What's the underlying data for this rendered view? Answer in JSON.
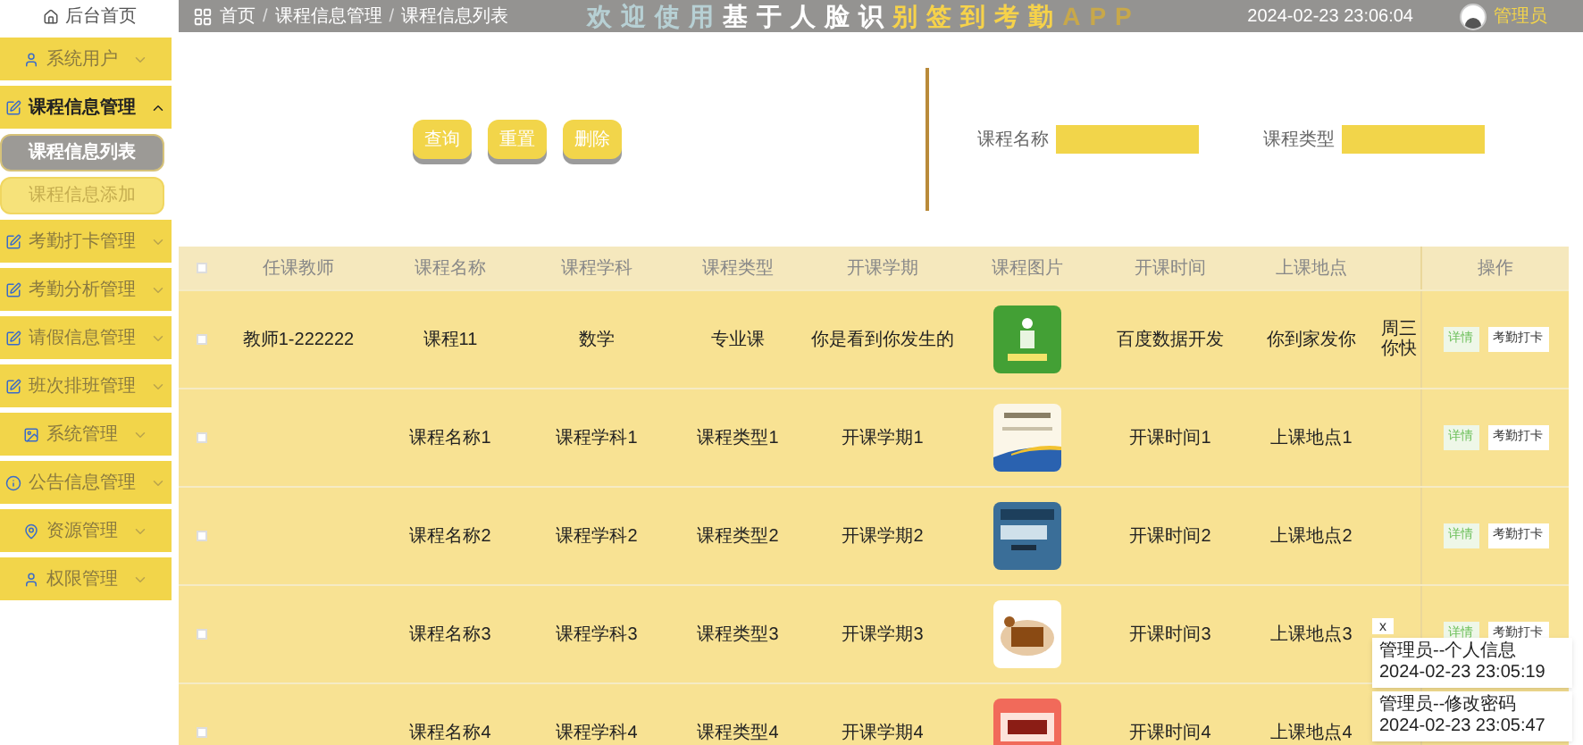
{
  "sidebar": {
    "home": "后台首页",
    "items": [
      {
        "label": "系统用户",
        "expanded": false
      },
      {
        "label": "课程信息管理",
        "expanded": true,
        "children": [
          {
            "label": "课程信息列表",
            "selected": true
          },
          {
            "label": "课程信息添加",
            "selected": false
          }
        ]
      },
      {
        "label": "考勤打卡管理",
        "expanded": false
      },
      {
        "label": "考勤分析管理",
        "expanded": false
      },
      {
        "label": "请假信息管理",
        "expanded": false
      },
      {
        "label": "班次排班管理",
        "expanded": false
      },
      {
        "label": "系统管理",
        "expanded": false
      },
      {
        "label": "公告信息管理",
        "expanded": false
      },
      {
        "label": "资源管理",
        "expanded": false
      },
      {
        "label": "权限管理",
        "expanded": false
      }
    ]
  },
  "header": {
    "breadcrumb": [
      {
        "kind": "link",
        "text": "首页"
      },
      {
        "kind": "separator",
        "text": "/"
      },
      {
        "kind": "link",
        "text": "课程信息管理"
      },
      {
        "kind": "separator",
        "text": "/"
      },
      {
        "kind": "link",
        "text": "课程信息列表"
      }
    ],
    "title": "欢迎使用基于人脸识别签到考勤APP",
    "time": "2024-02-23 23:06:04",
    "user": "管理员"
  },
  "actions": [
    "查询",
    "重置",
    "删除"
  ],
  "search": [
    {
      "label": "课程名称"
    },
    {
      "label": "课程类型"
    }
  ],
  "table": {
    "select_all_checked": false,
    "columns": [
      "任课教师",
      "课程名称",
      "课程学科",
      "课程类型",
      "开课学期",
      "课程图片",
      "开课时间",
      "上课地点",
      "操作"
    ],
    "rows": [
      {
        "checked": false,
        "cells": [
          "教师1-222222",
          "课程11",
          "数学",
          "专业课",
          "你是看到你发生的",
          "",
          "百度数据开发",
          "你到家发你"
        ],
        "column_9": [
          "周三",
          "你快"
        ],
        "ops": [
          "详情",
          "考勤打卡"
        ]
      },
      {
        "checked": false,
        "cells": [
          "",
          "课程名称1",
          "课程学科1",
          "课程类型1",
          "开课学期1",
          "",
          "开课时间1",
          "上课地点1"
        ],
        "ops": [
          "详情",
          "考勤打卡"
        ]
      },
      {
        "checked": false,
        "cells": [
          "",
          "课程名称2",
          "课程学科2",
          "课程类型2",
          "开课学期2",
          "",
          "开课时间2",
          "上课地点2"
        ],
        "ops": [
          "详情",
          "考勤打卡"
        ]
      },
      {
        "checked": false,
        "cells": [
          "",
          "课程名称3",
          "课程学科3",
          "课程类型3",
          "开课学期3",
          "",
          "开课时间3",
          "上课地点3"
        ],
        "ops": [
          "详情",
          "考勤打卡"
        ]
      },
      {
        "checked": false,
        "cells": [
          "",
          "课程名称4",
          "课程学科4",
          "课程类型4",
          "开课学期4",
          "",
          "开课时间4",
          "上课地点4"
        ]
      }
    ]
  },
  "notifications": {
    "close": "x",
    "items": [
      "管理员--个人信息 2024-02-23 23:05:19",
      "管理员--修改密码 2024-02-23 23:05:47"
    ]
  }
}
